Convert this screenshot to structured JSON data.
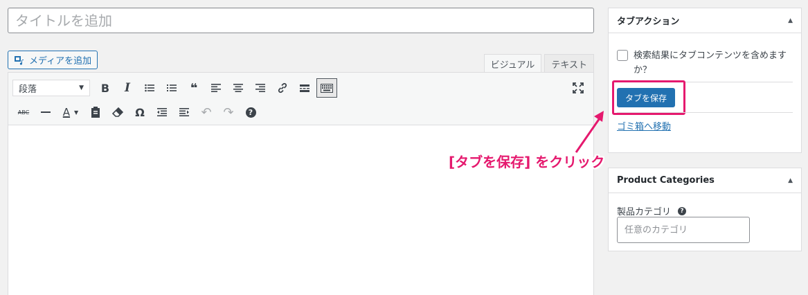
{
  "post": {
    "title_placeholder": "タイトルを追加"
  },
  "editor": {
    "add_media_label": "メディアを追加",
    "tabs": [
      {
        "label": "ビジュアル",
        "active": true
      },
      {
        "label": "テキスト",
        "active": false
      }
    ],
    "format_select": "段落",
    "toolbar_row1": [
      "bold-icon",
      "italic-icon",
      "bullet-list-icon",
      "numbered-list-icon",
      "blockquote-icon",
      "align-left-icon",
      "align-center-icon",
      "align-right-icon",
      "link-icon",
      "read-more-icon",
      "toolbar-toggle-icon"
    ],
    "toolbar_row2": [
      "strikethrough-icon",
      "horizontal-line-icon",
      "text-color-icon",
      "paste-text-icon",
      "clear-formatting-icon",
      "special-character-icon",
      "outdent-icon",
      "indent-icon",
      "undo-icon",
      "redo-icon",
      "help-icon"
    ],
    "glyphs": {
      "bold": "B",
      "italic": "I",
      "blockquote": "❝",
      "omega": "Ω",
      "help": "?",
      "strike": "ABC",
      "text_color": "A",
      "undo": "↶",
      "redo": "↷",
      "select_arrow": "▼",
      "collapse": "▲"
    }
  },
  "tab_action": {
    "title": "タブアクション",
    "checkbox_label": "検索結果にタブコンテンツを含めますか？",
    "save_label": "タブを保存",
    "trash_label": "ゴミ箱へ移動"
  },
  "product_categories": {
    "title": "Product Categories",
    "field_label": "製品カテゴリ",
    "input_placeholder": "任意のカテゴリ"
  },
  "annotation": {
    "text": "[タブを保存] をクリック",
    "color": "#e5196e"
  },
  "colors": {
    "primary": "#2271b1",
    "highlight": "#e5196e"
  }
}
